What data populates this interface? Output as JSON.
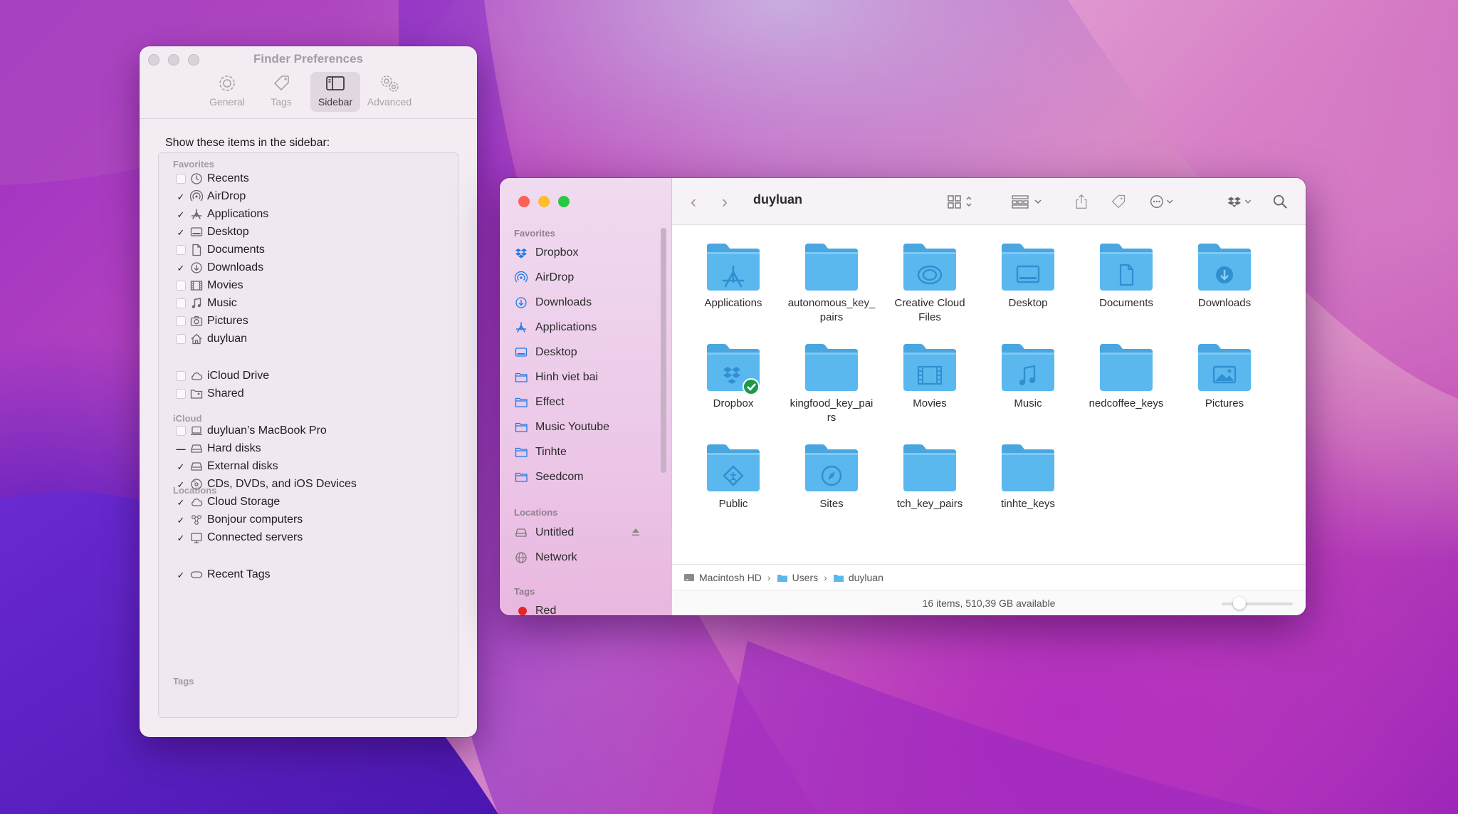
{
  "colors": {
    "folder_blue": "#5ab8ef",
    "folder_tab": "#4aa6e0",
    "accent": "#1a73e8"
  },
  "prefs": {
    "title": "Finder Preferences",
    "tabs": [
      {
        "label": "General",
        "icon": "gear-icon"
      },
      {
        "label": "Tags",
        "icon": "tag-icon"
      },
      {
        "label": "Sidebar",
        "icon": "sidebar-icon",
        "selected": true
      },
      {
        "label": "Advanced",
        "icon": "gears-icon"
      }
    ],
    "show_label": "Show these items in the sidebar:",
    "sections": {
      "favorites": "Favorites",
      "icloud": "iCloud",
      "locations": "Locations",
      "tags": "Tags"
    },
    "items": [
      {
        "label": "Recents",
        "state": "off",
        "icon": "clock-icon"
      },
      {
        "label": "AirDrop",
        "state": "on",
        "icon": "airdrop-icon"
      },
      {
        "label": "Applications",
        "state": "on",
        "icon": "applications-icon"
      },
      {
        "label": "Desktop",
        "state": "on",
        "icon": "desktop-icon"
      },
      {
        "label": "Documents",
        "state": "off",
        "icon": "document-icon"
      },
      {
        "label": "Downloads",
        "state": "on",
        "icon": "download-icon"
      },
      {
        "label": "Movies",
        "state": "off",
        "icon": "film-icon"
      },
      {
        "label": "Music",
        "state": "off",
        "icon": "music-note-icon"
      },
      {
        "label": "Pictures",
        "state": "off",
        "icon": "camera-icon"
      },
      {
        "label": "duyluan",
        "state": "off",
        "icon": "home-icon"
      },
      {
        "label": "iCloud Drive",
        "state": "off",
        "icon": "cloud-icon"
      },
      {
        "label": "Shared",
        "state": "off",
        "icon": "shared-folder-icon"
      },
      {
        "label": "duyluan’s MacBook Pro",
        "state": "off",
        "icon": "laptop-icon"
      },
      {
        "label": "Hard disks",
        "state": "mixed",
        "icon": "hard-disk-icon"
      },
      {
        "label": "External disks",
        "state": "on",
        "icon": "external-disk-icon"
      },
      {
        "label": "CDs, DVDs, and iOS Devices",
        "state": "on",
        "icon": "disc-icon"
      },
      {
        "label": "Cloud Storage",
        "state": "on",
        "icon": "cloud-icon"
      },
      {
        "label": "Bonjour computers",
        "state": "on",
        "icon": "bonjour-icon"
      },
      {
        "label": "Connected servers",
        "state": "on",
        "icon": "server-icon"
      },
      {
        "label": "Recent Tags",
        "state": "on",
        "icon": "tag-outline-icon"
      }
    ],
    "check_glyph": "✓",
    "mixed_glyph": "—"
  },
  "finder": {
    "title": "duyluan",
    "back": "‹",
    "forward": "›",
    "sidebar": {
      "favorites_label": "Favorites",
      "favorites": [
        {
          "label": "Dropbox",
          "icon": "dropbox-icon"
        },
        {
          "label": "AirDrop",
          "icon": "airdrop-icon"
        },
        {
          "label": "Downloads",
          "icon": "download-icon"
        },
        {
          "label": "Applications",
          "icon": "applications-icon"
        },
        {
          "label": "Desktop",
          "icon": "desktop-icon"
        },
        {
          "label": "Hinh viet bai",
          "icon": "folder-icon"
        },
        {
          "label": "Effect",
          "icon": "folder-icon"
        },
        {
          "label": "Music Youtube",
          "icon": "folder-icon"
        },
        {
          "label": "Tinhte",
          "icon": "folder-icon"
        },
        {
          "label": "Seedcom",
          "icon": "folder-icon"
        }
      ],
      "locations_label": "Locations",
      "locations": [
        {
          "label": "Untitled",
          "icon": "disk-icon"
        },
        {
          "label": "Network",
          "icon": "globe-icon"
        }
      ],
      "tags_label": "Tags",
      "tags": [
        {
          "label": "Red",
          "color": "#e8242b"
        }
      ]
    },
    "files": [
      {
        "name": "Applications",
        "glyph": "applications"
      },
      {
        "name": "autonomous_key_\npairs",
        "glyph": "none"
      },
      {
        "name": "Creative Cloud\nFiles",
        "glyph": "cc"
      },
      {
        "name": "Desktop",
        "glyph": "desktop"
      },
      {
        "name": "Documents",
        "glyph": "doc"
      },
      {
        "name": "Downloads",
        "glyph": "download"
      },
      {
        "name": "Dropbox",
        "glyph": "dropbox"
      },
      {
        "name": "kingfood_key_pai\nrs",
        "glyph": "none"
      },
      {
        "name": "Movies",
        "glyph": "film"
      },
      {
        "name": "Music",
        "glyph": "music"
      },
      {
        "name": "nedcoffee_keys",
        "glyph": "none"
      },
      {
        "name": "Pictures",
        "glyph": "picture"
      },
      {
        "name": "Public",
        "glyph": "public"
      },
      {
        "name": "Sites",
        "glyph": "compass"
      },
      {
        "name": "tch_key_pairs",
        "glyph": "none"
      },
      {
        "name": "tinhte_keys",
        "glyph": "none"
      }
    ],
    "path": [
      "Macintosh HD",
      "Users",
      "duyluan"
    ],
    "path_sep": "›",
    "status": "16 items, 510,39 GB available"
  }
}
